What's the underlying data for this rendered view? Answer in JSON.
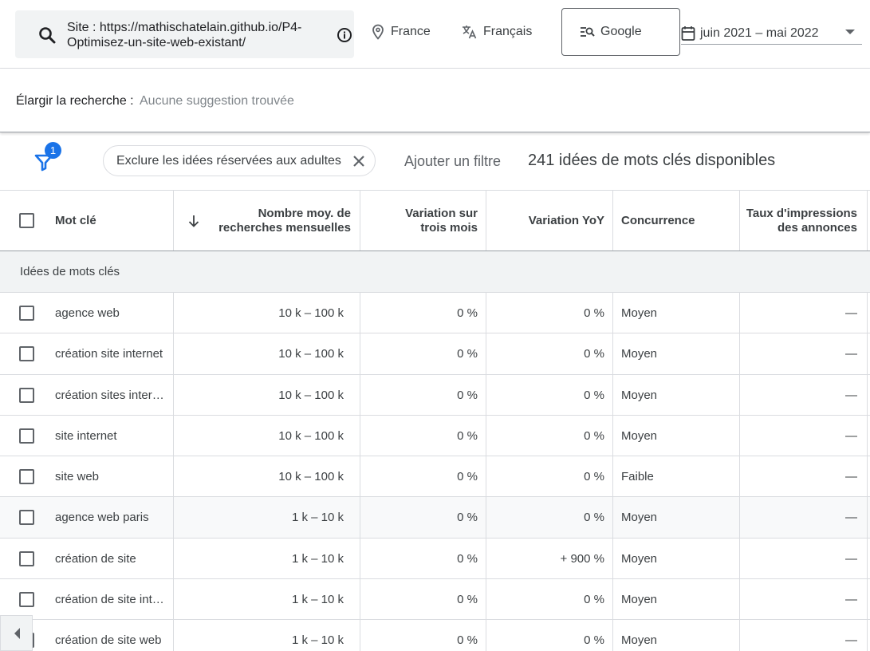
{
  "search": {
    "line1": "Site : https://mathischatelain.github.io/P4-",
    "line2": "Optimisez-un-site-web-existant/"
  },
  "location": "France",
  "language": "Français",
  "network": "Google",
  "date_range": "juin 2021 – mai 2022",
  "broaden": {
    "label": "Élargir la recherche :",
    "value": "Aucune suggestion trouvée"
  },
  "filters": {
    "badge_count": "1",
    "adult_chip": "Exclure les idées réservées aux adultes",
    "add_filter": "Ajouter un filtre",
    "ideas_count": "241 idées de mots clés disponibles"
  },
  "columns": {
    "keyword": "Mot clé",
    "volume_line1": "Nombre moy. de",
    "volume_line2": "recherches mensuelles",
    "three_month_line1": "Variation sur",
    "three_month_line2": "trois mois",
    "yoy": "Variation YoY",
    "competition": "Concurrence",
    "impr_line1": "Taux d'impressions",
    "impr_line2": "des annonces"
  },
  "group_label": "Idées de mots clés",
  "rows": [
    {
      "keyword": "agence web",
      "volume": "10 k – 100 k",
      "three_month": "0 %",
      "yoy": "0 %",
      "competition": "Moyen",
      "impr": "—"
    },
    {
      "keyword": "création site internet",
      "volume": "10 k – 100 k",
      "three_month": "0 %",
      "yoy": "0 %",
      "competition": "Moyen",
      "impr": "—"
    },
    {
      "keyword": "création sites inter…",
      "volume": "10 k – 100 k",
      "three_month": "0 %",
      "yoy": "0 %",
      "competition": "Moyen",
      "impr": "—"
    },
    {
      "keyword": "site internet",
      "volume": "10 k – 100 k",
      "three_month": "0 %",
      "yoy": "0 %",
      "competition": "Moyen",
      "impr": "—"
    },
    {
      "keyword": "site web",
      "volume": "10 k – 100 k",
      "three_month": "0 %",
      "yoy": "0 %",
      "competition": "Faible",
      "impr": "—"
    },
    {
      "keyword": "agence web paris",
      "volume": "1 k – 10 k",
      "three_month": "0 %",
      "yoy": "0 %",
      "competition": "Moyen",
      "impr": "—"
    },
    {
      "keyword": "création de site",
      "volume": "1 k – 10 k",
      "three_month": "0 %",
      "yoy": "+ 900 %",
      "competition": "Moyen",
      "impr": "—"
    },
    {
      "keyword": "création de site int…",
      "volume": "1 k – 10 k",
      "three_month": "0 %",
      "yoy": "0 %",
      "competition": "Moyen",
      "impr": "—"
    },
    {
      "keyword": "création de site web",
      "volume": "1 k – 10 k",
      "three_month": "0 %",
      "yoy": "0 %",
      "competition": "Moyen",
      "impr": "—"
    }
  ],
  "colors": {
    "accent": "#1a73e8",
    "header_bg": "#f1f3f4"
  }
}
